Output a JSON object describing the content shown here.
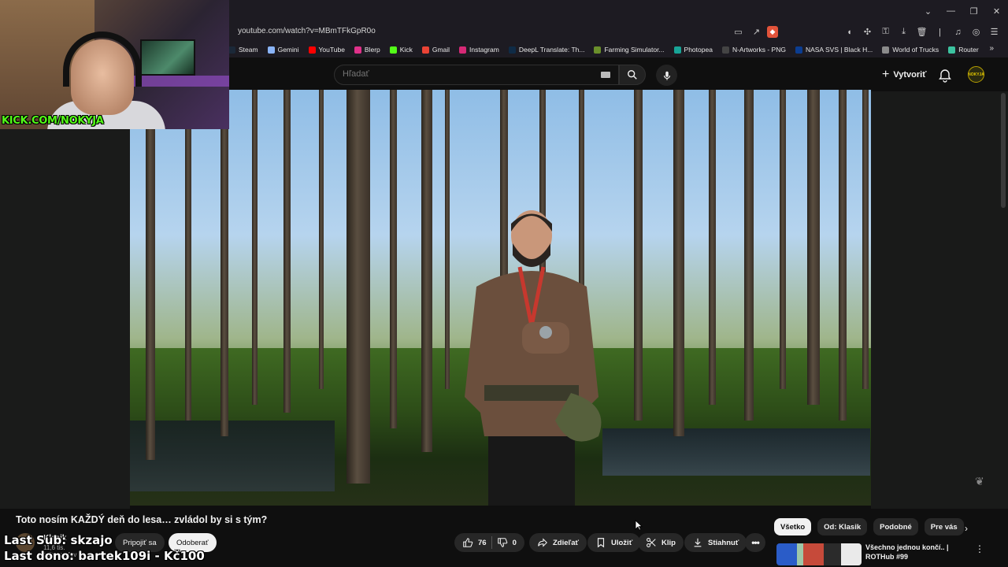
{
  "browser": {
    "url": "youtube.com/watch?v=MBmTFkGpR0o",
    "bookmarks": [
      {
        "label": "Steam",
        "color": "#1b2838"
      },
      {
        "label": "Gemini",
        "color": "#8ab4f8"
      },
      {
        "label": "YouTube",
        "color": "#ff0000"
      },
      {
        "label": "Blerp",
        "color": "#e0318a"
      },
      {
        "label": "Kick",
        "color": "#53fc18"
      },
      {
        "label": "Gmail",
        "color": "#ea4335"
      },
      {
        "label": "Instagram",
        "color": "#d62976"
      },
      {
        "label": "DeepL Translate: Th...",
        "color": "#0f2b46"
      },
      {
        "label": "Farming Simulator...",
        "color": "#6a8f2b"
      },
      {
        "label": "Photopea",
        "color": "#18a497"
      },
      {
        "label": "N-Artworks - PNG",
        "color": "#444444"
      },
      {
        "label": "NASA SVS | Black H...",
        "color": "#0b3d91"
      },
      {
        "label": "World of Trucks",
        "color": "#8b8b8b"
      },
      {
        "label": "Router",
        "color": "#3cc3a0"
      }
    ]
  },
  "header": {
    "search_placeholder": "Hľadať",
    "create_label": "Vytvoriť",
    "avatar_text": "NOKYJA"
  },
  "webcam": {
    "kick_tag": "KICK.COM/NOKYJA"
  },
  "video": {
    "title": "Toto nosím KAŽDÝ deň do lesa… zvládol by si s tým?",
    "channel_name": "Klasik",
    "subscribers": "11,6 tis. odberateľov",
    "join_label": "Pripojiť sa",
    "unsubscribe_label": "Odoberať",
    "likes": "76",
    "dislikes": "0",
    "share_label": "Zdieľať",
    "save_label": "Uložiť",
    "clip_label": "Klip",
    "download_label": "Stiahnuť"
  },
  "overlay": {
    "last_sub": "Last Sub: skzajo",
    "last_dono": "Last dono: bartek109i - Kč100"
  },
  "filters": [
    "Všetko",
    "Od: Klasik",
    "Podobné",
    "Pre vás"
  ],
  "recommendation": {
    "title": "Všechno jednou končí.. | ROTHub #99"
  }
}
